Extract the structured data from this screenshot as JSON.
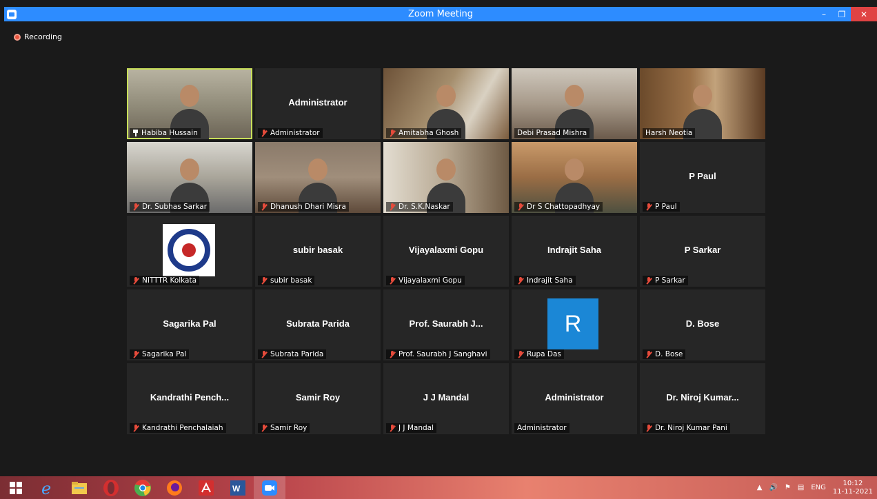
{
  "window": {
    "title": "Zoom Meeting"
  },
  "recording": {
    "label": "Recording"
  },
  "tiles": [
    {
      "display": "",
      "label": "Habiba Hussain",
      "kind": "video",
      "bg": "v1",
      "icon": "pin",
      "active": true
    },
    {
      "display": "Administrator",
      "label": "Administrator",
      "kind": "name",
      "icon": "mic-off"
    },
    {
      "display": "",
      "label": "Amitabha Ghosh",
      "kind": "video",
      "bg": "v3",
      "icon": "mic-off"
    },
    {
      "display": "",
      "label": "Debi Prasad Mishra",
      "kind": "video",
      "bg": "v4",
      "icon": "none"
    },
    {
      "display": "",
      "label": "Harsh Neotia",
      "kind": "video",
      "bg": "v5",
      "icon": "none"
    },
    {
      "display": "",
      "label": "Dr. Subhas Sarkar",
      "kind": "video",
      "bg": "v6",
      "icon": "mic-off"
    },
    {
      "display": "",
      "label": "Dhanush Dhari Misra",
      "kind": "video",
      "bg": "v7",
      "icon": "mic-off"
    },
    {
      "display": "",
      "label": "Dr. S.K.Naskar",
      "kind": "video",
      "bg": "v8",
      "icon": "mic-off"
    },
    {
      "display": "",
      "label": "Dr S Chattopadhyay",
      "kind": "video",
      "bg": "v9",
      "icon": "mic-off"
    },
    {
      "display": "P Paul",
      "label": "P Paul",
      "kind": "name",
      "icon": "mic-off"
    },
    {
      "display": "",
      "label": "NITTTR Kolkata",
      "kind": "logo",
      "icon": "mic-off"
    },
    {
      "display": "subir basak",
      "label": "subir basak",
      "kind": "name",
      "icon": "mic-off"
    },
    {
      "display": "Vijayalaxmi Gopu",
      "label": "Vijayalaxmi Gopu",
      "kind": "name",
      "icon": "mic-off"
    },
    {
      "display": "Indrajit Saha",
      "label": "Indrajit Saha",
      "kind": "name",
      "icon": "mic-off"
    },
    {
      "display": "P Sarkar",
      "label": "P Sarkar",
      "kind": "name",
      "icon": "mic-off"
    },
    {
      "display": "Sagarika Pal",
      "label": "Sagarika Pal",
      "kind": "name",
      "icon": "mic-off"
    },
    {
      "display": "Subrata Parida",
      "label": "Subrata Parida",
      "kind": "name",
      "icon": "mic-off"
    },
    {
      "display": "Prof. Saurabh J...",
      "label": "Prof. Saurabh J Sanghavi",
      "kind": "name",
      "icon": "mic-off"
    },
    {
      "display": "R",
      "label": "Rupa Das",
      "kind": "avatar",
      "icon": "mic-off"
    },
    {
      "display": "D. Bose",
      "label": "D. Bose",
      "kind": "name",
      "icon": "mic-off"
    },
    {
      "display": "Kandrathi  Pench...",
      "label": "Kandrathi Penchalaiah",
      "kind": "name",
      "icon": "mic-off"
    },
    {
      "display": "Samir Roy",
      "label": "Samir Roy",
      "kind": "name",
      "icon": "mic-off"
    },
    {
      "display": "J J Mandal",
      "label": "J J Mandal",
      "kind": "name",
      "icon": "mic-off"
    },
    {
      "display": "Administrator",
      "label": "Administrator",
      "kind": "name",
      "icon": "none"
    },
    {
      "display": "Dr. Niroj Kumar...",
      "label": "Dr. Niroj Kumar Pani",
      "kind": "name",
      "icon": "mic-off"
    }
  ],
  "taskbar": {
    "apps": [
      {
        "name": "start-button-icon"
      },
      {
        "name": "internet-explorer-icon",
        "color": "#1e90ff"
      },
      {
        "name": "file-explorer-icon",
        "color": "#f2c94c"
      },
      {
        "name": "opera-icon",
        "color": "#d32f2f"
      },
      {
        "name": "chrome-icon",
        "color": "#4caf50"
      },
      {
        "name": "firefox-icon",
        "color": "#ff7b1c"
      },
      {
        "name": "acrobat-icon",
        "color": "#d32f2f"
      },
      {
        "name": "word-icon",
        "color": "#2b579a"
      },
      {
        "name": "zoom-icon",
        "color": "#2d8cff"
      }
    ],
    "tray": {
      "language": "ENG",
      "time": "10:12",
      "date": "11-11-2021"
    }
  }
}
